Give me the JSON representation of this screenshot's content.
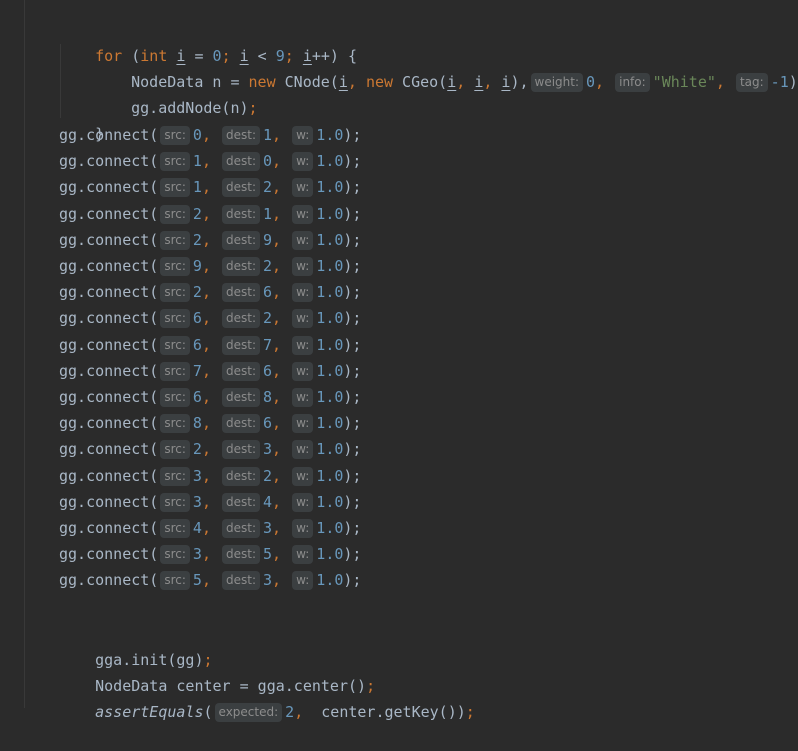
{
  "for_line": {
    "kw_for": "for",
    "open": " (",
    "kw_int": "int",
    "sp1": " ",
    "var_i1": "i",
    "eq": " = ",
    "zero": "0",
    "semi1": "; ",
    "var_i2": "i",
    "lt": " < ",
    "nine": "9",
    "semi2": "; ",
    "var_i3": "i",
    "tail": "++) {"
  },
  "node_line": {
    "decl": "NodeData n = ",
    "kw_new1": "new",
    "cnode": " CNode(",
    "var_i1": "i",
    "comma1": ", ",
    "kw_new2": "new",
    "cgeo": " CGeo(",
    "var_i2": "i",
    "comma2": ", ",
    "var_i3": "i",
    "comma3": ", ",
    "var_i4": "i",
    "close_geo": "),",
    "hint_weight": "weight:",
    "weight_val": "0",
    "comma4": ",",
    "hint_info": "info:",
    "info_val": "\"White\"",
    "comma5": ",",
    "hint_tag": "tag:",
    "tag_val": "-1",
    "end": ");"
  },
  "add_line": {
    "call": "gg.addNode(n)",
    "semi": ";"
  },
  "close_brace": "}",
  "connect": {
    "prefix": "gg.connect(",
    "hint_src": "src:",
    "hint_dest": "dest:",
    "hint_w": "w:",
    "comma": ",",
    "end": ");",
    "calls": [
      {
        "src": "0",
        "dest": "1",
        "w": "1.0"
      },
      {
        "src": "1",
        "dest": "0",
        "w": "1.0"
      },
      {
        "src": "1",
        "dest": "2",
        "w": "1.0"
      },
      {
        "src": "2",
        "dest": "1",
        "w": "1.0"
      },
      {
        "src": "2",
        "dest": "9",
        "w": "1.0"
      },
      {
        "src": "9",
        "dest": "2",
        "w": "1.0"
      },
      {
        "src": "2",
        "dest": "6",
        "w": "1.0"
      },
      {
        "src": "6",
        "dest": "2",
        "w": "1.0"
      },
      {
        "src": "6",
        "dest": "7",
        "w": "1.0"
      },
      {
        "src": "7",
        "dest": "6",
        "w": "1.0"
      },
      {
        "src": "6",
        "dest": "8",
        "w": "1.0"
      },
      {
        "src": "8",
        "dest": "6",
        "w": "1.0"
      },
      {
        "src": "2",
        "dest": "3",
        "w": "1.0"
      },
      {
        "src": "3",
        "dest": "2",
        "w": "1.0"
      },
      {
        "src": "3",
        "dest": "4",
        "w": "1.0"
      },
      {
        "src": "4",
        "dest": "3",
        "w": "1.0"
      },
      {
        "src": "3",
        "dest": "5",
        "w": "1.0"
      },
      {
        "src": "5",
        "dest": "3",
        "w": "1.0"
      }
    ]
  },
  "init_line": {
    "call": "gga.init(gg)",
    "semi": ";"
  },
  "center_line": {
    "call": "NodeData center = gga.center()",
    "semi": ";"
  },
  "assert_line": {
    "fn": "assertEquals",
    "open": "(",
    "hint_expected": "expected:",
    "expected_val": "2",
    "comma": ",",
    "rest": " center.getKey())",
    "semi": ";"
  },
  "colors": {
    "background": "#2b2b2b",
    "keyword": "#cc7832",
    "number": "#6897bb",
    "string": "#6a8759",
    "identifier": "#a9b7c6",
    "hint_bg": "#3b3f41",
    "hint_fg": "#8c8c8c"
  }
}
